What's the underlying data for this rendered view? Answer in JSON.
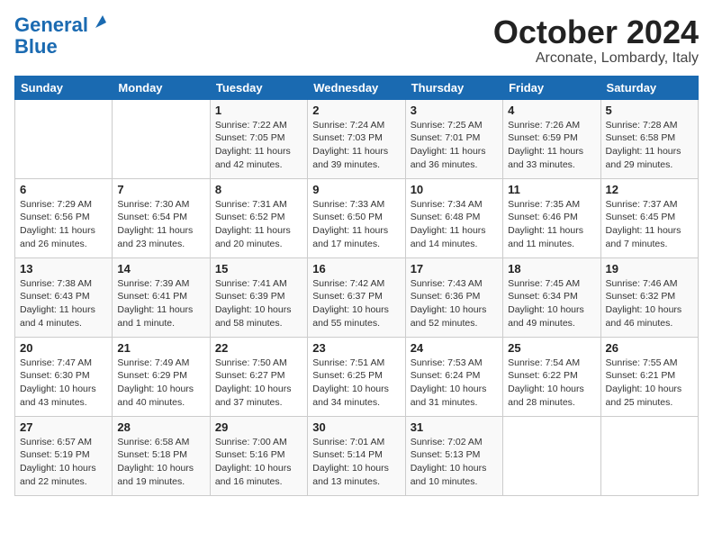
{
  "logo": {
    "line1": "General",
    "line2": "Blue"
  },
  "title": "October 2024",
  "subtitle": "Arconate, Lombardy, Italy",
  "days_header": [
    "Sunday",
    "Monday",
    "Tuesday",
    "Wednesday",
    "Thursday",
    "Friday",
    "Saturday"
  ],
  "weeks": [
    [
      {
        "day": "",
        "info": ""
      },
      {
        "day": "",
        "info": ""
      },
      {
        "day": "1",
        "info": "Sunrise: 7:22 AM\nSunset: 7:05 PM\nDaylight: 11 hours and 42 minutes."
      },
      {
        "day": "2",
        "info": "Sunrise: 7:24 AM\nSunset: 7:03 PM\nDaylight: 11 hours and 39 minutes."
      },
      {
        "day": "3",
        "info": "Sunrise: 7:25 AM\nSunset: 7:01 PM\nDaylight: 11 hours and 36 minutes."
      },
      {
        "day": "4",
        "info": "Sunrise: 7:26 AM\nSunset: 6:59 PM\nDaylight: 11 hours and 33 minutes."
      },
      {
        "day": "5",
        "info": "Sunrise: 7:28 AM\nSunset: 6:58 PM\nDaylight: 11 hours and 29 minutes."
      }
    ],
    [
      {
        "day": "6",
        "info": "Sunrise: 7:29 AM\nSunset: 6:56 PM\nDaylight: 11 hours and 26 minutes."
      },
      {
        "day": "7",
        "info": "Sunrise: 7:30 AM\nSunset: 6:54 PM\nDaylight: 11 hours and 23 minutes."
      },
      {
        "day": "8",
        "info": "Sunrise: 7:31 AM\nSunset: 6:52 PM\nDaylight: 11 hours and 20 minutes."
      },
      {
        "day": "9",
        "info": "Sunrise: 7:33 AM\nSunset: 6:50 PM\nDaylight: 11 hours and 17 minutes."
      },
      {
        "day": "10",
        "info": "Sunrise: 7:34 AM\nSunset: 6:48 PM\nDaylight: 11 hours and 14 minutes."
      },
      {
        "day": "11",
        "info": "Sunrise: 7:35 AM\nSunset: 6:46 PM\nDaylight: 11 hours and 11 minutes."
      },
      {
        "day": "12",
        "info": "Sunrise: 7:37 AM\nSunset: 6:45 PM\nDaylight: 11 hours and 7 minutes."
      }
    ],
    [
      {
        "day": "13",
        "info": "Sunrise: 7:38 AM\nSunset: 6:43 PM\nDaylight: 11 hours and 4 minutes."
      },
      {
        "day": "14",
        "info": "Sunrise: 7:39 AM\nSunset: 6:41 PM\nDaylight: 11 hours and 1 minute."
      },
      {
        "day": "15",
        "info": "Sunrise: 7:41 AM\nSunset: 6:39 PM\nDaylight: 10 hours and 58 minutes."
      },
      {
        "day": "16",
        "info": "Sunrise: 7:42 AM\nSunset: 6:37 PM\nDaylight: 10 hours and 55 minutes."
      },
      {
        "day": "17",
        "info": "Sunrise: 7:43 AM\nSunset: 6:36 PM\nDaylight: 10 hours and 52 minutes."
      },
      {
        "day": "18",
        "info": "Sunrise: 7:45 AM\nSunset: 6:34 PM\nDaylight: 10 hours and 49 minutes."
      },
      {
        "day": "19",
        "info": "Sunrise: 7:46 AM\nSunset: 6:32 PM\nDaylight: 10 hours and 46 minutes."
      }
    ],
    [
      {
        "day": "20",
        "info": "Sunrise: 7:47 AM\nSunset: 6:30 PM\nDaylight: 10 hours and 43 minutes."
      },
      {
        "day": "21",
        "info": "Sunrise: 7:49 AM\nSunset: 6:29 PM\nDaylight: 10 hours and 40 minutes."
      },
      {
        "day": "22",
        "info": "Sunrise: 7:50 AM\nSunset: 6:27 PM\nDaylight: 10 hours and 37 minutes."
      },
      {
        "day": "23",
        "info": "Sunrise: 7:51 AM\nSunset: 6:25 PM\nDaylight: 10 hours and 34 minutes."
      },
      {
        "day": "24",
        "info": "Sunrise: 7:53 AM\nSunset: 6:24 PM\nDaylight: 10 hours and 31 minutes."
      },
      {
        "day": "25",
        "info": "Sunrise: 7:54 AM\nSunset: 6:22 PM\nDaylight: 10 hours and 28 minutes."
      },
      {
        "day": "26",
        "info": "Sunrise: 7:55 AM\nSunset: 6:21 PM\nDaylight: 10 hours and 25 minutes."
      }
    ],
    [
      {
        "day": "27",
        "info": "Sunrise: 6:57 AM\nSunset: 5:19 PM\nDaylight: 10 hours and 22 minutes."
      },
      {
        "day": "28",
        "info": "Sunrise: 6:58 AM\nSunset: 5:18 PM\nDaylight: 10 hours and 19 minutes."
      },
      {
        "day": "29",
        "info": "Sunrise: 7:00 AM\nSunset: 5:16 PM\nDaylight: 10 hours and 16 minutes."
      },
      {
        "day": "30",
        "info": "Sunrise: 7:01 AM\nSunset: 5:14 PM\nDaylight: 10 hours and 13 minutes."
      },
      {
        "day": "31",
        "info": "Sunrise: 7:02 AM\nSunset: 5:13 PM\nDaylight: 10 hours and 10 minutes."
      },
      {
        "day": "",
        "info": ""
      },
      {
        "day": "",
        "info": ""
      }
    ]
  ]
}
